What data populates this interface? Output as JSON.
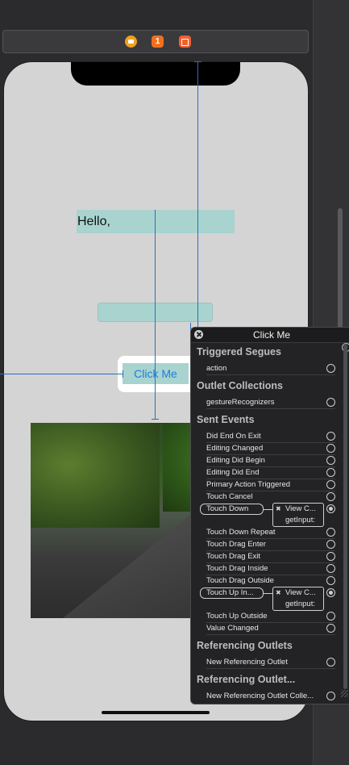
{
  "canvas": {
    "scene_icons": [
      {
        "name": "view-controller-icon",
        "color": "#f0a020"
      },
      {
        "name": "first-responder-icon",
        "color": "#f07020"
      },
      {
        "name": "exit-icon",
        "color": "#f06030"
      }
    ]
  },
  "phone": {
    "hello_label": "Hello,",
    "text_field_value": "",
    "button_label": "Click Me",
    "image": "road-through-forest-photo"
  },
  "connections_panel": {
    "title": "Click Me",
    "sections": {
      "triggered_segues": {
        "heading": "Triggered Segues",
        "rows": [
          "action"
        ]
      },
      "outlet_collections": {
        "heading": "Outlet Collections",
        "rows": [
          "gestureRecognizers"
        ]
      },
      "sent_events": {
        "heading": "Sent Events",
        "rows": [
          "Did End On Exit",
          "Editing Changed",
          "Editing Did Begin",
          "Editing Did End",
          "Primary Action Triggered",
          "Touch Cancel",
          "Touch Down",
          "Touch Down Repeat",
          "Touch Drag Enter",
          "Touch Drag Exit",
          "Touch Drag Inside",
          "Touch Drag Outside",
          "Touch Up In...",
          "Touch Up Outside",
          "Value Changed"
        ],
        "touch_down_target": {
          "line1": "View C...",
          "line2": "getInput:"
        },
        "touch_up_target": {
          "line1": "View C...",
          "line2": "getInput:"
        }
      },
      "referencing_outlets": {
        "heading": "Referencing Outlets",
        "rows": [
          "New Referencing Outlet"
        ]
      },
      "referencing_outlet_collections": {
        "heading": "Referencing Outlet...",
        "rows": [
          "New Referencing Outlet Colle..."
        ]
      }
    }
  }
}
